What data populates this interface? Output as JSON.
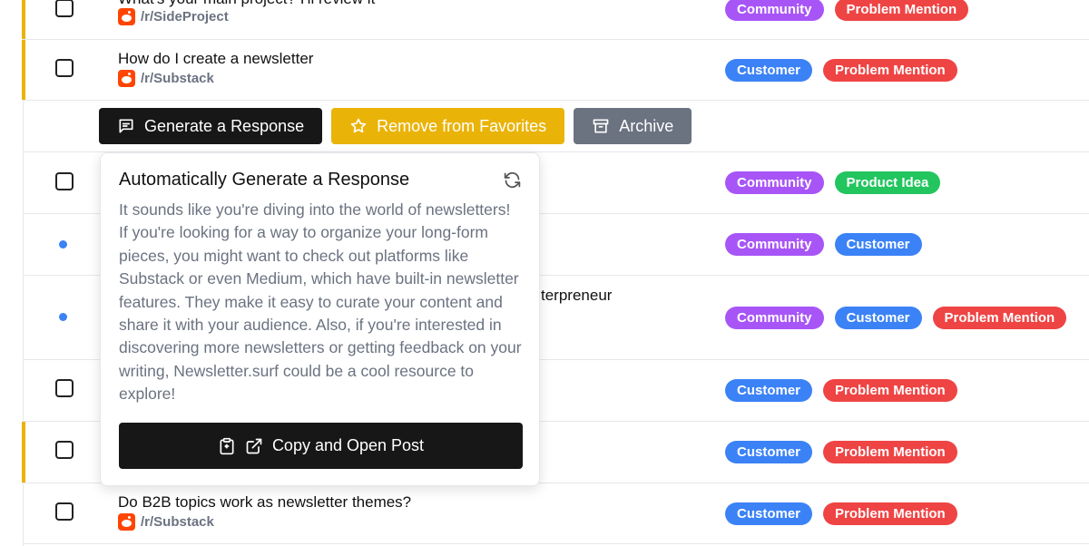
{
  "colors": {
    "community": "#a855f7",
    "customer": "#3b82f6",
    "problem_mention": "#ef4444",
    "product_idea": "#22c55e",
    "favorite_accent": "#eab308",
    "generate_button": "#171717",
    "archive_button": "#6b7280"
  },
  "rows": [
    {
      "title": "What's your main project? I'll review it",
      "subreddit": "/r/SideProject",
      "tags": [
        "Community",
        "Problem Mention"
      ]
    },
    {
      "title": "How do I create a newsletter",
      "subreddit": "/r/Substack",
      "tags": [
        "Customer",
        "Problem Mention"
      ]
    },
    {
      "tags": [
        "Community",
        "Product Idea"
      ]
    },
    {
      "tags": [
        "Community",
        "Customer"
      ]
    },
    {
      "title_fragment": "terpreneur",
      "tags": [
        "Community",
        "Customer",
        "Problem Mention"
      ]
    },
    {
      "tags": [
        "Customer",
        "Problem Mention"
      ]
    },
    {
      "tags": [
        "Customer",
        "Problem Mention"
      ]
    },
    {
      "title": "Do B2B topics work as newsletter themes?",
      "subreddit": "/r/Substack",
      "tags": [
        "Customer",
        "Problem Mention"
      ]
    }
  ],
  "actions": {
    "generate": "Generate a Response",
    "remove_favorite": "Remove from Favorites",
    "archive": "Archive"
  },
  "popover": {
    "title": "Automatically Generate a Response",
    "body": "It sounds like you're diving into the world of newsletters! If you're looking for a way to organize your long-form pieces, you might want to check out platforms like Substack or even Medium, which have built-in newsletter features. They make it easy to curate your content and share it with your audience. Also, if you're interested in discovering more newsletters or getting feedback on your writing, Newsletter.surf could be a cool resource to explore!",
    "copy_button": "Copy and Open Post"
  }
}
